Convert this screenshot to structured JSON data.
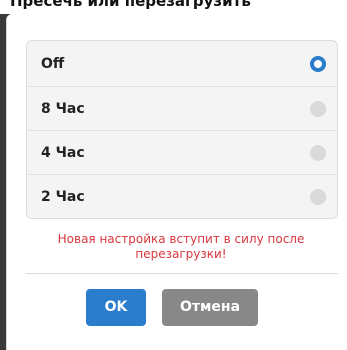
{
  "background_title": "Пресечь или перезагрузить",
  "options": [
    {
      "label": "Off",
      "selected": true
    },
    {
      "label": "8 Час",
      "selected": false
    },
    {
      "label": "4 Час",
      "selected": false
    },
    {
      "label": "2 Час",
      "selected": false
    }
  ],
  "note": "Новая настройка вступит в силу после перезагрузки!",
  "buttons": {
    "ok_label": "OK",
    "cancel_label": "Отмена"
  },
  "colors": {
    "accent": "#2a7ccc",
    "note": "#d9363e",
    "cancel": "#888888"
  }
}
